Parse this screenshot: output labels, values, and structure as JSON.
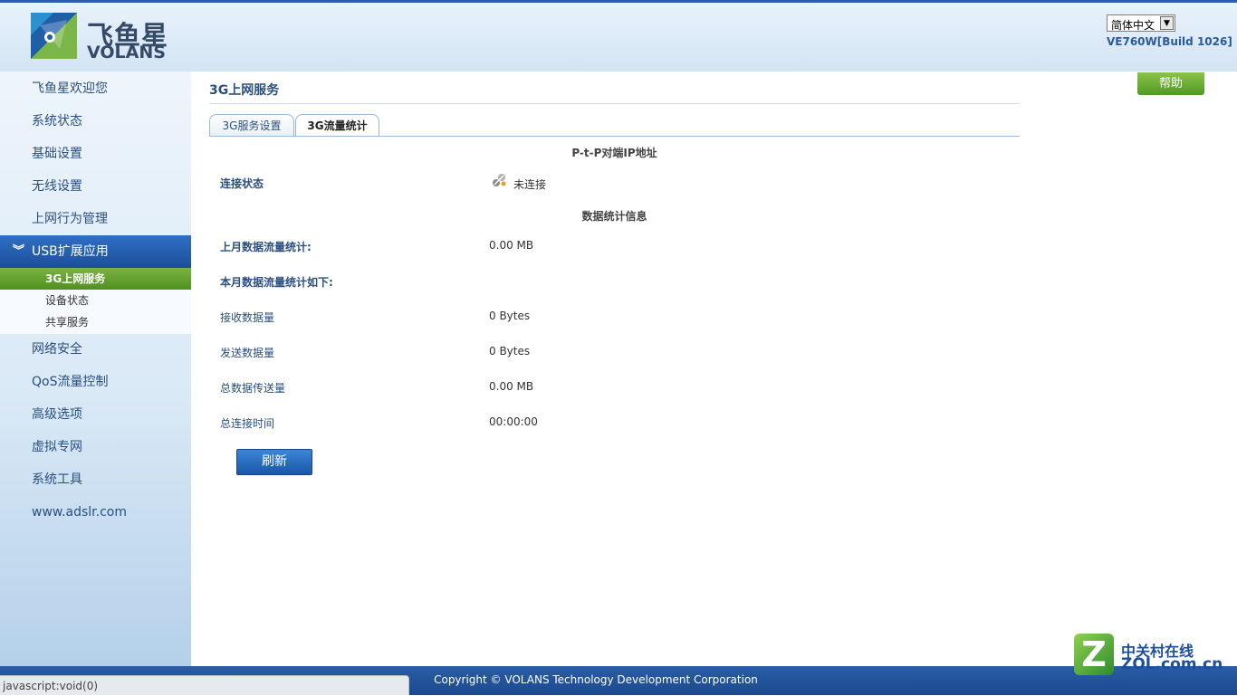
{
  "header": {
    "logo_cn": "飞鱼星",
    "logo_en": "VOLANS",
    "language": "简体中文",
    "build": "VE760W[Build 1026]"
  },
  "sidebar": {
    "items": [
      {
        "label": "飞鱼星欢迎您"
      },
      {
        "label": "系统状态"
      },
      {
        "label": "基础设置"
      },
      {
        "label": "无线设置"
      },
      {
        "label": "上网行为管理"
      },
      {
        "label": "USB扩展应用",
        "active": true
      },
      {
        "label": "网络安全"
      },
      {
        "label": "QoS流量控制"
      },
      {
        "label": "高级选项"
      },
      {
        "label": "虚拟专网"
      },
      {
        "label": "系统工具"
      },
      {
        "label": "www.adslr.com"
      }
    ],
    "subitems": [
      {
        "label": "3G上网服务",
        "active": true
      },
      {
        "label": "设备状态"
      },
      {
        "label": "共享服务"
      }
    ]
  },
  "main": {
    "title": "3G上网服务",
    "help_label": "帮助",
    "tabs": [
      {
        "label": "3G服务设置"
      },
      {
        "label": "3G流量统计",
        "active": true
      }
    ],
    "ptp_heading": "P-t-P对端IP地址",
    "connection_label": "连接状态",
    "connection_value": "未连接",
    "stats_heading": "数据统计信息",
    "last_month_label": "上月数据流量统计:",
    "last_month_value": "0.00 MB",
    "this_month_label": "本月数据流量统计如下:",
    "rows": [
      {
        "label": "接收数据量",
        "value": "0 Bytes"
      },
      {
        "label": "发送数据量",
        "value": "0 Bytes"
      },
      {
        "label": "总数据传送量",
        "value": "0.00 MB"
      },
      {
        "label": "总连接时间",
        "value": "00:00:00"
      }
    ],
    "refresh_label": "刷新"
  },
  "footer": {
    "copyright": "Copyright © VOLANS Technology Development Corporation"
  },
  "statusbar": {
    "text": "javascript:void(0)"
  },
  "watermark": {
    "letter": "Z",
    "cn": "中关村在线",
    "en": "ZOL.com.cn"
  },
  "colors": {
    "accent": "#1d4f9a",
    "active_sub": "#4f8f1f",
    "help_button": "#6aaa2e"
  }
}
